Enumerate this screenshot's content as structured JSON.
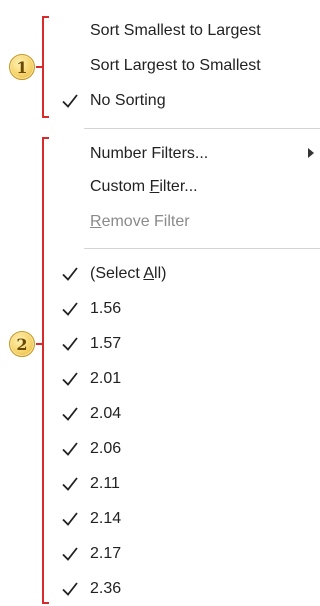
{
  "markers": [
    {
      "number": "1"
    },
    {
      "number": "2"
    }
  ],
  "sort_section": {
    "items": [
      {
        "label": "Sort Smallest to Largest",
        "checked": false
      },
      {
        "label": "Sort Largest to Smallest",
        "checked": false
      },
      {
        "label": "No Sorting",
        "checked": true
      }
    ]
  },
  "filter_section": {
    "number_filters": {
      "label": "Number Filters..."
    },
    "custom_filter": {
      "pre": "Custom ",
      "accel": "F",
      "post": "ilter..."
    },
    "remove_filter": {
      "accel": "R",
      "post": "emove Filter",
      "enabled": false
    }
  },
  "values_section": {
    "select_all": {
      "pre": "(Select ",
      "accel": "A",
      "post": "ll)",
      "checked": true
    },
    "values": [
      "1.56",
      "1.57",
      "2.01",
      "2.04",
      "2.06",
      "2.11",
      "2.14",
      "2.17",
      "2.36"
    ]
  },
  "colors": {
    "bracket": "#d92b2b",
    "badge": "#f6d36a",
    "disabled_text": "#8a8a8a"
  }
}
